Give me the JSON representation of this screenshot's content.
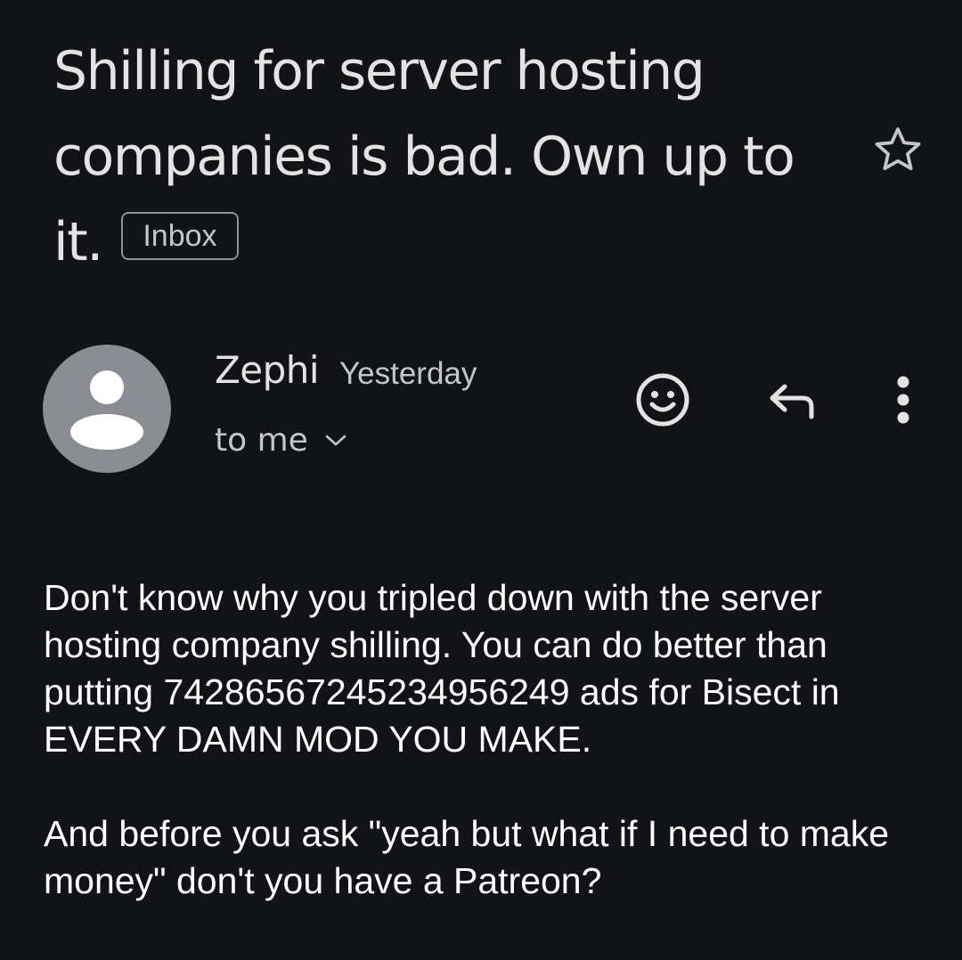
{
  "subject": {
    "title": "Shilling for server hosting companies is bad. Own up to it.",
    "label_chip": "Inbox"
  },
  "sender": {
    "name": "Zephi",
    "time": "Yesterday",
    "recipient": "to me"
  },
  "icons": {
    "star": "star-outline-icon",
    "avatar": "person-icon",
    "chevron": "chevron-down-icon",
    "emoji": "emoji-reaction-icon",
    "reply": "reply-icon",
    "more": "more-vert-icon"
  },
  "message": {
    "paragraphs": [
      "Don't know why you tripled down with the server hosting company shilling. You can do better than putting 742865672452349562​49 ads for Bisect in EVERY DAMN MOD YOU MAKE.",
      "And before you ask \"yeah but what if I need to make money\" don't you have a Patreon?"
    ]
  },
  "colors": {
    "background": "#121317",
    "text_primary": "#e3e3e3",
    "text_secondary": "#c4c7c5",
    "avatar_bg": "#8a8d92"
  }
}
